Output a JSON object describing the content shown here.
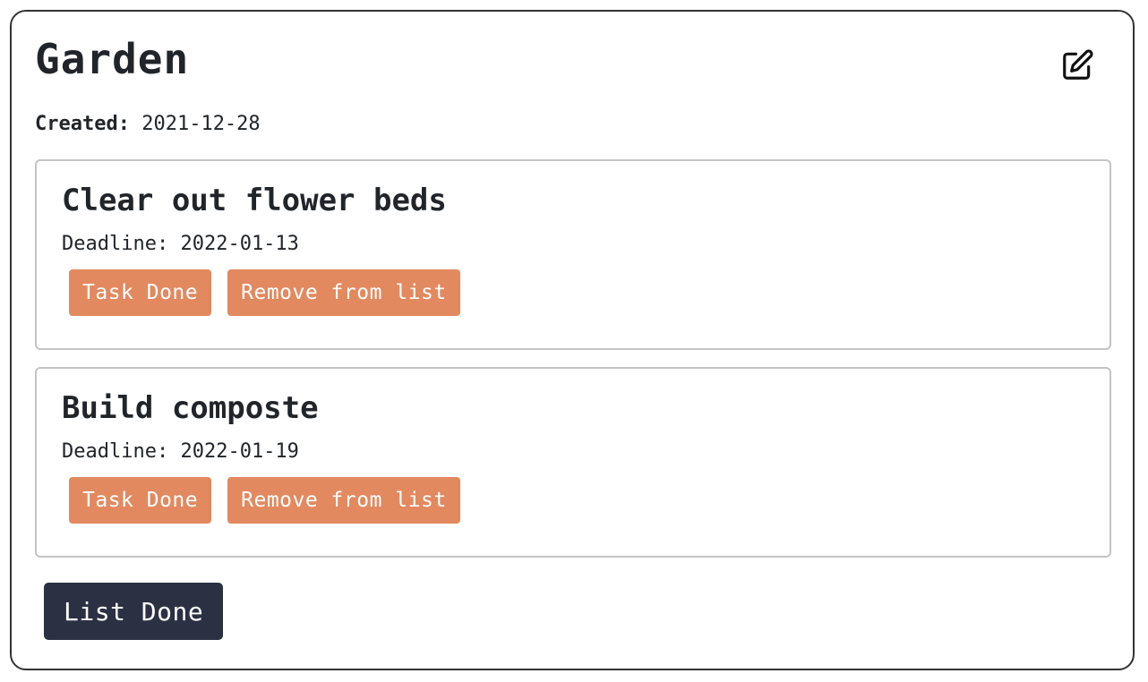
{
  "list": {
    "title": "Garden",
    "created_label": "Created:",
    "created_value": "2021-12-28",
    "edit_icon": "edit-icon"
  },
  "tasks": [
    {
      "title": "Clear out flower beds",
      "deadline_label": "Deadline:",
      "deadline_value": "2022-01-13",
      "done_label": "Task Done",
      "remove_label": "Remove from list"
    },
    {
      "title": "Build composte",
      "deadline_label": "Deadline:",
      "deadline_value": "2022-01-19",
      "done_label": "Task Done",
      "remove_label": "Remove from list"
    }
  ],
  "footer": {
    "list_done_label": "List Done"
  },
  "colors": {
    "task_button": "#e2895f",
    "list_done_button": "#2b3043",
    "card_border": "#333333",
    "task_border": "#c4c4c4"
  }
}
